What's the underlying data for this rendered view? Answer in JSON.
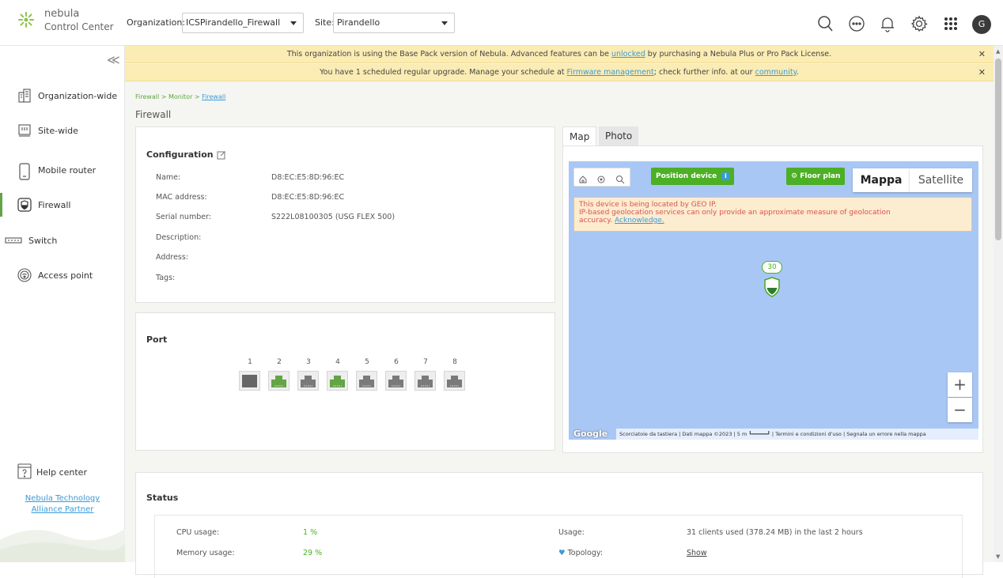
{
  "app": {
    "logo_line1": "nebula",
    "logo_line2": "Control Center"
  },
  "header": {
    "org_label": "Organization:",
    "org_value": "ICSPirandello_Firewall",
    "site_label": "Site:",
    "site_value": "Pirandello",
    "avatar_initial": "G",
    "icons": [
      "search-icon",
      "chat-icon",
      "bell-icon",
      "gear-icon",
      "apps-grid-icon"
    ]
  },
  "sidebar": {
    "collapse_glyph": "≪",
    "items": [
      {
        "label": "Organization-wide",
        "icon": "building-icon"
      },
      {
        "label": "Site-wide",
        "icon": "site-icon"
      },
      {
        "label": "Mobile router",
        "icon": "mobile-router-icon"
      },
      {
        "label": "Firewall",
        "icon": "shield-icon",
        "active": true
      },
      {
        "label": "Switch",
        "icon": "switch-icon"
      },
      {
        "label": "Access point",
        "icon": "access-point-icon"
      }
    ],
    "help_label": "Help center",
    "partner_line1": "Nebula Technology",
    "partner_line2": "Alliance Partner"
  },
  "banners": [
    {
      "text_before": "This organization is using the Base Pack version of Nebula. Advanced features can be ",
      "link": "unlocked",
      "text_after": " by purchasing a Nebula Plus or Pro Pack License."
    },
    {
      "text_before": "You have 1 scheduled regular upgrade. Manage your schedule at ",
      "link": "Firmware management",
      "text_middle": "; check further info. at our ",
      "link2": "community",
      "text_after": "."
    }
  ],
  "breadcrumb": {
    "part1": "Firewall > Monitor > ",
    "link": "Firewall"
  },
  "page_title": "Firewall",
  "configuration": {
    "title": "Configuration",
    "fields": [
      {
        "label": "Name:",
        "value": "D8:EC:E5:8D:96:EC"
      },
      {
        "label": "MAC address:",
        "value": "D8:EC:E5:8D:96:EC"
      },
      {
        "label": "Serial number:",
        "value": "S222L08100305 (USG FLEX 500)"
      },
      {
        "label": "Description:",
        "value": ""
      },
      {
        "label": "Address:",
        "value": ""
      },
      {
        "label": "Tags:",
        "value": ""
      }
    ]
  },
  "port": {
    "title": "Port",
    "ports": [
      {
        "num": "1",
        "status": "disabled"
      },
      {
        "num": "2",
        "status": "connected"
      },
      {
        "num": "3",
        "status": "idle"
      },
      {
        "num": "4",
        "status": "connected"
      },
      {
        "num": "5",
        "status": "idle"
      },
      {
        "num": "6",
        "status": "idle"
      },
      {
        "num": "7",
        "status": "idle"
      },
      {
        "num": "8",
        "status": "idle"
      }
    ],
    "colors": {
      "connected": "#64a346",
      "idle": "#7a7a7a",
      "disabled": "#666666"
    }
  },
  "map_panel": {
    "tabs": [
      "Map",
      "Photo"
    ],
    "position_btn": "Position device",
    "floor_plan_btn": "Floor plan",
    "map_types": [
      "Mappa",
      "Satellite"
    ],
    "warning_line1": "This device is being located by GEO IP.",
    "warning_line2": "IP-based geolocation services can only provide an approximate measure of geolocation",
    "warning_line3": "accuracy. ",
    "warning_link": "Acknowledge.",
    "pin_label": "30",
    "zoom_in": "+",
    "zoom_out": "−",
    "google": "Google",
    "attribution": "Scorciatoie da tastiera  |  Dati mappa ©2023  |  5 m ┗━━━━━┛  |  Termini e condizioni d'uso  |  Segnala un errore nella mappa"
  },
  "status": {
    "title": "Status",
    "left": [
      {
        "label": "CPU usage:",
        "value": "1 %"
      },
      {
        "label": "Memory usage:",
        "value": "29 %"
      }
    ],
    "right": [
      {
        "label": "Usage:",
        "value": "31 clients used (378.24 MB) in the last 2 hours"
      },
      {
        "label": "Topology:",
        "value": "Show"
      }
    ]
  },
  "colors": {
    "accent_green": "#64a346",
    "link_blue": "#3a9ad9",
    "banner_yellow": "#fbecb3",
    "map_water": "#a8c7f5"
  }
}
